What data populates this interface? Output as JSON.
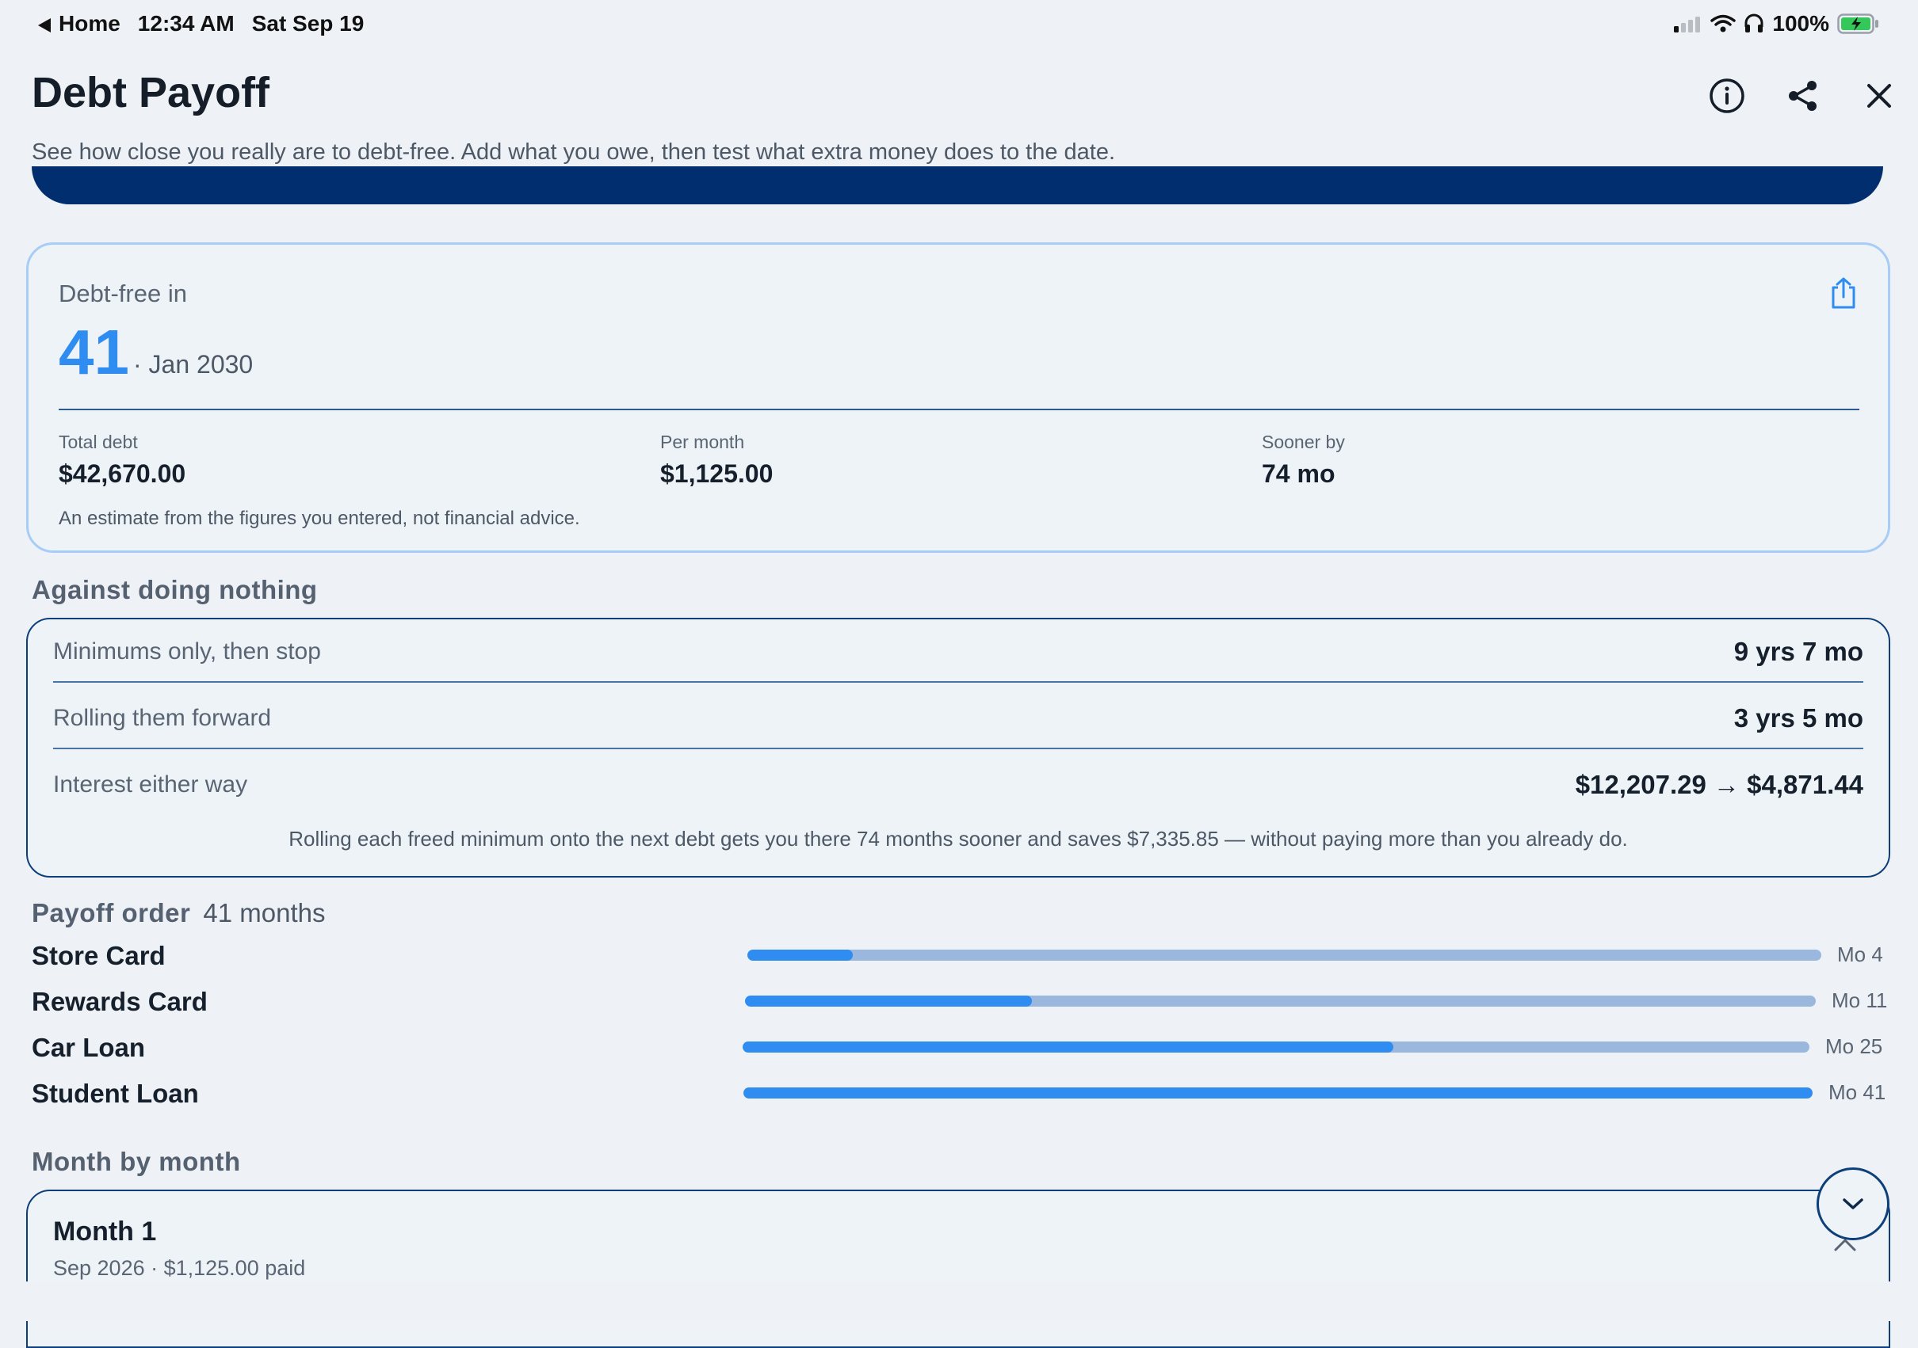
{
  "status": {
    "back_label": "Home",
    "time": "12:34 AM",
    "date": "Sat Sep 19",
    "battery": "100%"
  },
  "header": {
    "title": "Debt Payoff",
    "subtitle": "See how close you really are to debt-free. Add what you owe, then test what extra money does to the date."
  },
  "summary": {
    "label": "Debt-free in",
    "months": "41",
    "date": "· Jan 2030",
    "stats": [
      {
        "label": "Total debt",
        "value": "$42,670.00"
      },
      {
        "label": "Per month",
        "value": "$1,125.00"
      },
      {
        "label": "Sooner by",
        "value": "74 mo"
      }
    ],
    "note": "An estimate from the figures you entered, not financial advice."
  },
  "comparison": {
    "heading": "Against doing nothing",
    "rows": [
      {
        "label": "Minimums only, then stop",
        "value": "9 yrs 7 mo"
      },
      {
        "label": "Rolling them forward",
        "value": "3 yrs 5 mo"
      },
      {
        "label": "Interest either way",
        "value": "$12,207.29 → $4,871.44"
      }
    ],
    "footnote": "Rolling each freed minimum onto the next debt gets you there 74 months sooner and saves $7,335.85 — without paying more than you already do."
  },
  "payoff": {
    "heading": "Payoff order",
    "subheading": "41 months",
    "items": [
      {
        "name": "Store Card",
        "month_label": "Mo 4",
        "progress": 0.098
      },
      {
        "name": "Rewards Card",
        "month_label": "Mo 11",
        "progress": 0.268
      },
      {
        "name": "Car Loan",
        "month_label": "Mo 25",
        "progress": 0.61
      },
      {
        "name": "Student Loan",
        "month_label": "Mo 41",
        "progress": 1.0
      }
    ]
  },
  "months": {
    "heading": "Month by month",
    "first": {
      "title": "Month 1",
      "detail": "Sep 2026 · $1,125.00 paid"
    }
  },
  "icons": {
    "info": "info-icon",
    "share": "share-icon",
    "close": "close-icon",
    "export": "export-icon",
    "chevron_down": "chevron-down-icon",
    "chevron_up": "chevron-up-icon"
  },
  "colors": {
    "accent": "#2f8cf0",
    "navy": "#002e6e",
    "track": "#9ab8dd",
    "battery": "#34c759"
  }
}
